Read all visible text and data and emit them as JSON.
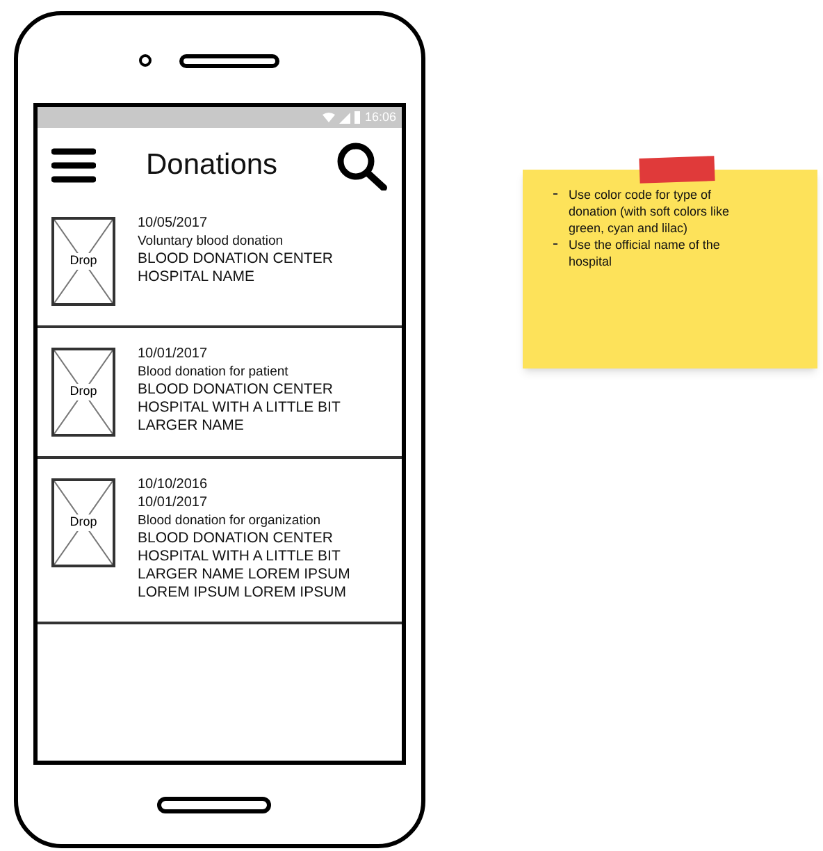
{
  "status_bar": {
    "time": "16:06"
  },
  "header": {
    "title": "Donations"
  },
  "donations": [
    {
      "dates": [
        "10/05/2017"
      ],
      "type": "Voluntary blood donation",
      "hospital": "BLOOD DONATION CENTER HOSPITAL NAME",
      "image_label": "Drop"
    },
    {
      "dates": [
        "10/01/2017"
      ],
      "type": "Blood donation for patient",
      "hospital": "BLOOD DONATION CENTER HOSPITAL WITH A LITTLE BIT LARGER NAME",
      "image_label": "Drop"
    },
    {
      "dates": [
        "10/10/2016",
        "10/01/2017"
      ],
      "type": "Blood donation for organization",
      "hospital": "BLOOD DONATION CENTER HOSPITAL WITH A LITTLE BIT LARGER NAME LOREM IPSUM LOREM IPSUM LOREM IPSUM",
      "image_label": "Drop"
    }
  ],
  "sticky_note": {
    "items": [
      "Use color code for type of donation (with soft colors like green, cyan and lilac)",
      "Use the official name of the hospital"
    ]
  }
}
